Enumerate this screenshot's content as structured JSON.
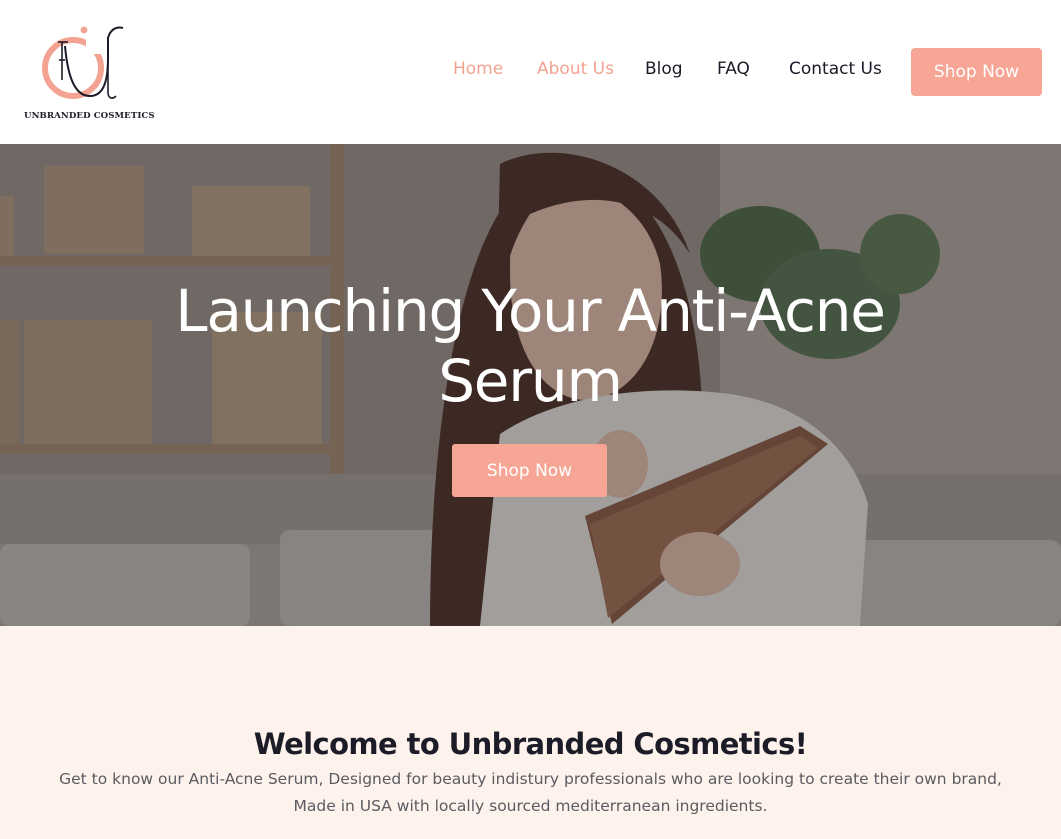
{
  "brand": {
    "name": "UNBRANDED COSMETICS",
    "logo_icon": "cu-monogram-logo",
    "accent_color": "#f7a595"
  },
  "nav": {
    "items": [
      {
        "label": "Home",
        "active": true
      },
      {
        "label": "About Us",
        "active": true
      },
      {
        "label": "Blog",
        "active": false
      },
      {
        "label": "FAQ",
        "active": false
      },
      {
        "label": "Contact Us",
        "active": false
      }
    ],
    "cta_label": "Shop Now"
  },
  "hero": {
    "title": "Launching Your Anti-Acne Serum",
    "cta_label": "Shop Now"
  },
  "welcome": {
    "title": "Welcome to Unbranded Cosmetics!",
    "body": "Get to know our Anti-Acne Serum, Designed for beauty indistury professionals who are looking to create their own brand, Made in USA with locally sourced mediterranean ingredients."
  }
}
